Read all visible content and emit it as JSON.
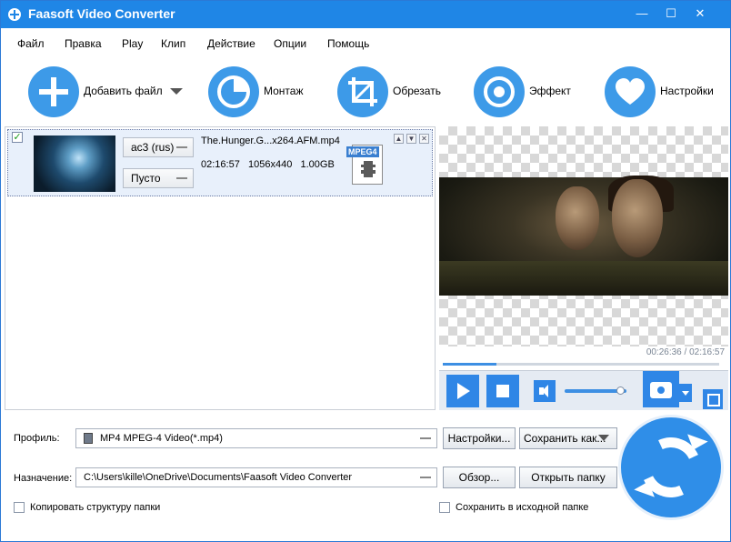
{
  "window": {
    "title": "Faasoft Video Converter",
    "controls": {
      "minimize": "—",
      "maximize": "☐",
      "close": "✕"
    }
  },
  "menu": [
    "Файл",
    "Правка",
    "Play",
    "Клип",
    "Действие",
    "Опции",
    "Помощь"
  ],
  "toolbar": {
    "add_file": "Добавить файл",
    "montage": "Монтаж",
    "crop": "Обрезать",
    "effect": "Эффект",
    "settings": "Настройки"
  },
  "file": {
    "checked": true,
    "audio_track": "ac3 (rus)",
    "subtitle": "Пусто",
    "name": "The.Hunger.G...x264.AFM.mp4",
    "duration": "02:16:57",
    "resolution": "1056x440",
    "size": "1.00GB",
    "format_badge": "MPEG4"
  },
  "preview": {
    "time": "00:26:36 / 02:16:57",
    "progress": 0.195,
    "volume": 0.9
  },
  "profile": {
    "label": "Профиль:",
    "value": "MP4 MPEG-4 Video(*.mp4)",
    "settings_button": "Настройки...",
    "save_as_button": "Сохранить как..."
  },
  "destination": {
    "label": "Назначение:",
    "value": "C:\\Users\\kille\\OneDrive\\Documents\\Faasoft Video Converter",
    "browse_button": "Обзор...",
    "open_folder_button": "Открыть папку"
  },
  "options": {
    "copy_structure": "Копировать структуру папки",
    "save_in_source": "Сохранить в исходной папке"
  },
  "colors": {
    "titlebar": "#1f86e6",
    "accent": "#2f86e6",
    "icon_blue": "#3d9ae8"
  }
}
